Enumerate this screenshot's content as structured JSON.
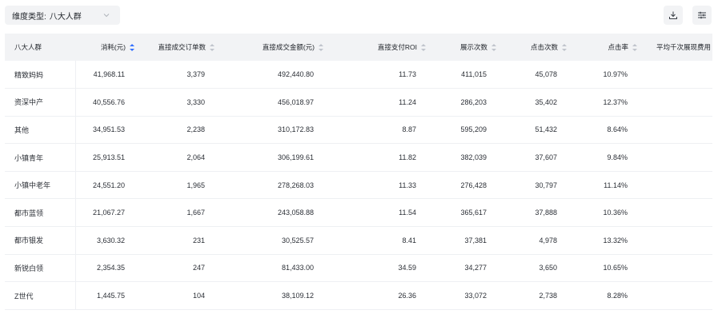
{
  "filter": {
    "label": "维度类型:",
    "value": "八大人群"
  },
  "toolbar": {
    "download_icon": "download-icon",
    "settings_icon": "sliders-icon"
  },
  "table": {
    "columns": [
      {
        "label": "八大人群",
        "sortable": false
      },
      {
        "label": "消耗(元)",
        "sortable": true,
        "active": true
      },
      {
        "label": "直接成交订单数",
        "sortable": true
      },
      {
        "label": "直接成交金额(元)",
        "sortable": true
      },
      {
        "label": "直接支付ROI",
        "sortable": true
      },
      {
        "label": "展示次数",
        "sortable": true
      },
      {
        "label": "点击次数",
        "sortable": true
      },
      {
        "label": "点击率",
        "sortable": true
      },
      {
        "label": "平均千次展现费用",
        "sortable": false
      }
    ],
    "rows": [
      [
        "精致妈妈",
        "41,968.11",
        "3,379",
        "492,440.80",
        "11.73",
        "411,015",
        "45,078",
        "10.97%",
        ""
      ],
      [
        "资深中产",
        "40,556.76",
        "3,330",
        "456,018.97",
        "11.24",
        "286,203",
        "35,402",
        "12.37%",
        ""
      ],
      [
        "其他",
        "34,951.53",
        "2,238",
        "310,172.83",
        "8.87",
        "595,209",
        "51,432",
        "8.64%",
        ""
      ],
      [
        "小镇青年",
        "25,913.51",
        "2,064",
        "306,199.61",
        "11.82",
        "382,039",
        "37,607",
        "9.84%",
        ""
      ],
      [
        "小镇中老年",
        "24,551.20",
        "1,965",
        "278,268.03",
        "11.33",
        "276,428",
        "30,797",
        "11.14%",
        ""
      ],
      [
        "都市蓝领",
        "21,067.27",
        "1,667",
        "243,058.88",
        "11.54",
        "365,617",
        "37,888",
        "10.36%",
        ""
      ],
      [
        "都市银发",
        "3,630.32",
        "231",
        "30,525.57",
        "8.41",
        "37,381",
        "4,978",
        "13.32%",
        ""
      ],
      [
        "新锐白领",
        "2,354.35",
        "247",
        "81,433.00",
        "34.59",
        "34,277",
        "3,650",
        "10.65%",
        ""
      ],
      [
        "Z世代",
        "1,445.75",
        "104",
        "38,109.12",
        "26.36",
        "33,072",
        "2,738",
        "8.28%",
        ""
      ]
    ]
  },
  "colors": {
    "accent": "#3370ff",
    "header_bg": "#f2f3f5"
  }
}
